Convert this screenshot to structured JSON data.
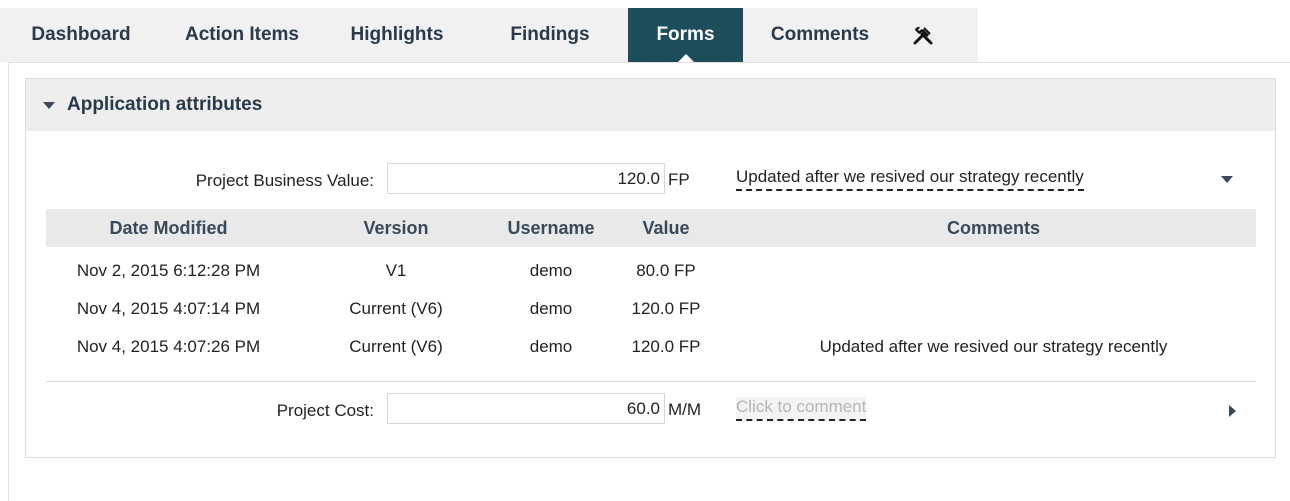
{
  "tabs": [
    {
      "label": "Dashboard"
    },
    {
      "label": "Action Items"
    },
    {
      "label": "Highlights"
    },
    {
      "label": "Findings"
    },
    {
      "label": "Forms",
      "active": true
    },
    {
      "label": "Comments"
    }
  ],
  "tools_icon": "tools-icon",
  "panel": {
    "title": "Application attributes",
    "attributes": [
      {
        "label": "Project Business Value:",
        "value": "120.0",
        "unit": "FP",
        "comment": "Updated after we resived our strategy recently"
      },
      {
        "label": "Project Cost:",
        "value": "60.0",
        "unit": "M/M",
        "comment": "Click to comment"
      }
    ],
    "history": {
      "columns": [
        "Date Modified",
        "Version",
        "Username",
        "Value",
        "Comments"
      ],
      "rows": [
        [
          "Nov 2, 2015 6:12:28 PM",
          "V1",
          "demo",
          "80.0 FP",
          ""
        ],
        [
          "Nov 4, 2015 4:07:14 PM",
          "Current (V6)",
          "demo",
          "120.0 FP",
          ""
        ],
        [
          "Nov 4, 2015 4:07:26 PM",
          "Current (V6)",
          "demo",
          "120.0 FP",
          "Updated after we resived our strategy recently"
        ]
      ]
    }
  },
  "colors": {
    "active_tab": "#1e4d5c",
    "tab_bar": "#f1f1f1",
    "header_bg": "#eeeeee"
  }
}
